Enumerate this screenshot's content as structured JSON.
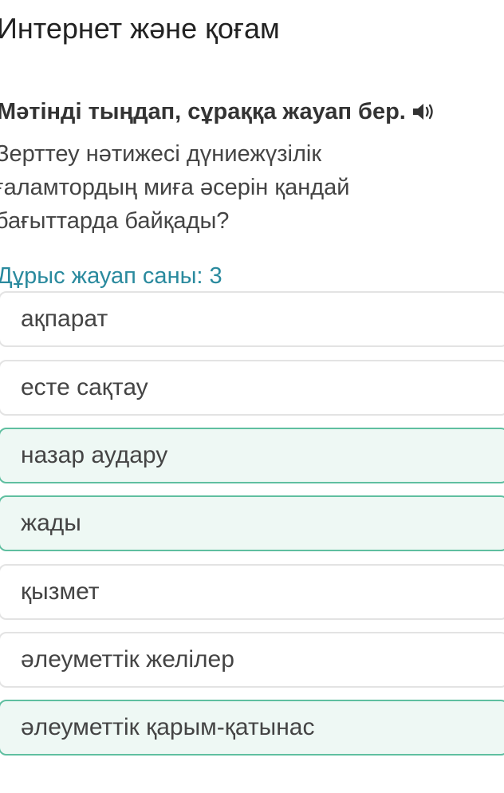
{
  "page_title": "Интернет және қоғам",
  "instruction": "Мәтінді тыңдап, сұраққа жауап бер.",
  "speaker_icon": "speaker-icon",
  "question_lines": [
    "Зерттеу нәтижесі дүниежүзілік",
    "ғаламтордың миға әсерін қандай",
    "бағыттарда байқады?"
  ],
  "answer_count": "Дұрыс жауап саны: 3",
  "colors": {
    "accent_text": "#2a8a9e",
    "selected_bg": "#eef8f4",
    "selected_border": "#5fbfa0",
    "default_border": "#e3e3e3"
  },
  "options": [
    {
      "label": "ақпарат",
      "selected": false
    },
    {
      "label": "есте сақтау",
      "selected": false
    },
    {
      "label": "назар аудару",
      "selected": true
    },
    {
      "label": "жады",
      "selected": true
    },
    {
      "label": "қызмет",
      "selected": false
    },
    {
      "label": "әлеуметтік желілер",
      "selected": false
    },
    {
      "label": "әлеуметтік қарым-қатынас",
      "selected": true
    }
  ]
}
